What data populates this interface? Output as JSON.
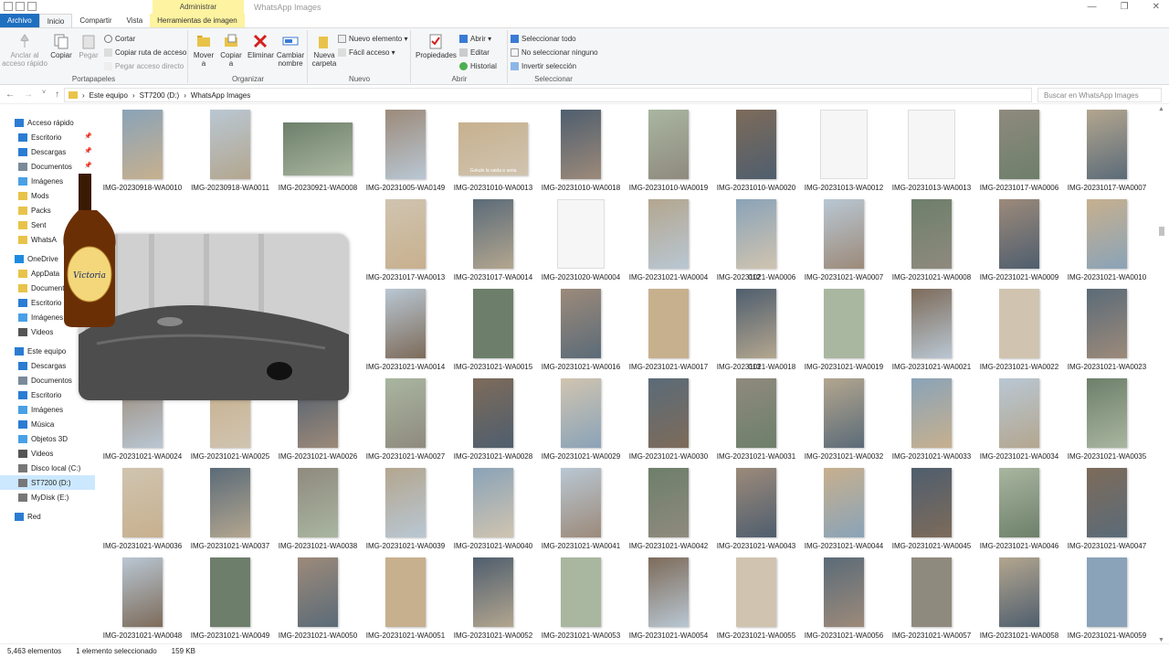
{
  "window": {
    "context_label": "Administrar",
    "title": "WhatsApp Images",
    "minimize": "—",
    "maximize": "❐",
    "close": "✕"
  },
  "tabs": [
    "Archivo",
    "Inicio",
    "Compartir",
    "Vista",
    "Herramientas de imagen"
  ],
  "ribbon": {
    "portapapeles": {
      "label": "Portapapeles",
      "anclar": "Anclar al acceso rápido",
      "copiar": "Copiar",
      "pegar": "Pegar",
      "cortar": "Cortar",
      "copiar_ruta": "Copiar ruta de acceso",
      "pegar_acceso": "Pegar acceso directo"
    },
    "organizar": {
      "label": "Organizar",
      "mover": "Mover a",
      "copiar_a": "Copiar a",
      "eliminar": "Eliminar",
      "cambiar": "Cambiar nombre"
    },
    "nuevo": {
      "label": "Nuevo",
      "carpeta": "Nueva carpeta",
      "elemento": "Nuevo elemento ▾",
      "facil": "Fácil acceso ▾"
    },
    "abrir": {
      "label": "Abrir",
      "propiedades": "Propiedades",
      "abrir": "Abrir ▾",
      "editar": "Editar",
      "historial": "Historial"
    },
    "seleccionar": {
      "label": "Seleccionar",
      "todo": "Seleccionar todo",
      "ninguno": "No seleccionar ninguno",
      "invertir": "Invertir selección"
    }
  },
  "address": {
    "path": [
      "Este equipo",
      "ST7200 (D:)",
      "WhatsApp Images"
    ],
    "search_placeholder": "Buscar en WhatsApp Images"
  },
  "sidebar": [
    {
      "label": "Acceso rápido",
      "color": "#2b7cd3"
    },
    {
      "label": "Escritorio",
      "color": "#2b7cd3"
    },
    {
      "label": "Descargas",
      "color": "#2b7cd3"
    },
    {
      "label": "Documentos",
      "color": "#7a8a99"
    },
    {
      "label": "Imágenes",
      "color": "#4aa0e6"
    },
    {
      "label": "Mods",
      "color": "#e8c34a"
    },
    {
      "label": "Packs",
      "color": "#e8c34a"
    },
    {
      "label": "Sent",
      "color": "#e8c34a"
    },
    {
      "label": "WhatsA",
      "color": "#e8c34a"
    },
    {
      "label": "OneDrive",
      "color": "#1f8ae0"
    },
    {
      "label": "AppData",
      "color": "#e8c34a"
    },
    {
      "label": "Documentos",
      "color": "#e8c34a"
    },
    {
      "label": "Escritorio",
      "color": "#2b7cd3"
    },
    {
      "label": "Imágenes",
      "color": "#4aa0e6"
    },
    {
      "label": "Videos",
      "color": "#555"
    },
    {
      "label": "Este equipo",
      "color": "#2b7cd3"
    },
    {
      "label": "Descargas",
      "color": "#2b7cd3"
    },
    {
      "label": "Documentos",
      "color": "#7a8a99"
    },
    {
      "label": "Escritorio",
      "color": "#2b7cd3"
    },
    {
      "label": "Imágenes",
      "color": "#4aa0e6"
    },
    {
      "label": "Música",
      "color": "#2b7cd3"
    },
    {
      "label": "Objetos 3D",
      "color": "#4aa0e6"
    },
    {
      "label": "Videos",
      "color": "#555"
    },
    {
      "label": "Disco local (C:)",
      "color": "#777"
    },
    {
      "label": "ST7200 (D:)",
      "color": "#777"
    },
    {
      "label": "MyDisk (E:)",
      "color": "#777"
    },
    {
      "label": "Red",
      "color": "#2b7cd3"
    }
  ],
  "files": [
    [
      "IMG-20230918-WA0010",
      "IMG-20230918-WA0011",
      "IMG-20230921-WA0008",
      "IMG-20231005-WA0149",
      "IMG-20231010-WA0013",
      "IMG-20231010-WA0018",
      "IMG-20231010-WA0019",
      "IMG-20231010-WA0020",
      "IMG-20231013-WA0012",
      "IMG-20231013-WA0013",
      "IMG-20231017-WA0006",
      "IMG-20231017-WA0007"
    ],
    [
      "",
      "",
      "",
      "IMG-20231017-WA0013",
      "IMG-20231017-WA0014",
      "IMG-20231020-WA0004",
      "IMG-20231021-WA0004",
      "IMG-20231021-WA0006",
      "IMG-20231021-WA0007",
      "IMG-20231021-WA0008",
      "IMG-20231021-WA0009",
      "IMG-20231021-WA0010"
    ],
    [
      "",
      "",
      "",
      "IMG-20231021-WA0014",
      "IMG-20231021-WA0015",
      "IMG-20231021-WA0016",
      "IMG-20231021-WA0017",
      "IMG-20231021-WA0018",
      "IMG-20231021-WA0019",
      "IMG-20231021-WA0021",
      "IMG-20231021-WA0022",
      "IMG-20231021-WA0023"
    ],
    [
      "IMG-20231021-WA0024",
      "IMG-20231021-WA0025",
      "IMG-20231021-WA0026",
      "IMG-20231021-WA0027",
      "IMG-20231021-WA0028",
      "IMG-20231021-WA0029",
      "IMG-20231021-WA0030",
      "IMG-20231021-WA0031",
      "IMG-20231021-WA0032",
      "IMG-20231021-WA0033",
      "IMG-20231021-WA0034",
      "IMG-20231021-WA0035"
    ],
    [
      "IMG-20231021-WA0036",
      "IMG-20231021-WA0037",
      "IMG-20231021-WA0038",
      "IMG-20231021-WA0039",
      "IMG-20231021-WA0040",
      "IMG-20231021-WA0041",
      "IMG-20231021-WA0042",
      "IMG-20231021-WA0043",
      "IMG-20231021-WA0044",
      "IMG-20231021-WA0045",
      "IMG-20231021-WA0046",
      "IMG-20231021-WA0047"
    ],
    [
      "IMG-20231021-WA0048",
      "IMG-20231021-WA0049",
      "IMG-20231021-WA0050",
      "IMG-20231021-WA0051",
      "IMG-20231021-WA0052",
      "IMG-20231021-WA0053",
      "IMG-20231021-WA0054",
      "IMG-20231021-WA0055",
      "IMG-20231021-WA0056",
      "IMG-20231021-WA0057",
      "IMG-20231021-WA0058",
      "IMG-20231021-WA0059"
    ]
  ],
  "partial_labels": [
    "012",
    "013"
  ],
  "doc_files": [
    "IMG-20231013-WA0012",
    "IMG-20231013-WA0013",
    "IMG-20231020-WA0004"
  ],
  "landscape_files": [
    "IMG-20230921-WA0008",
    "IMG-20231010-WA0013"
  ],
  "sticker_text": "Gokule la vaida e seria",
  "bottle_label": "Victoria",
  "status": {
    "count": "5,463 elementos",
    "selected": "1 elemento seleccionado",
    "size": "159 KB"
  },
  "colors": {
    "file_tab": "#1f6fc0",
    "context": "#fdf3a0",
    "selected_nav": "#cce8ff"
  }
}
